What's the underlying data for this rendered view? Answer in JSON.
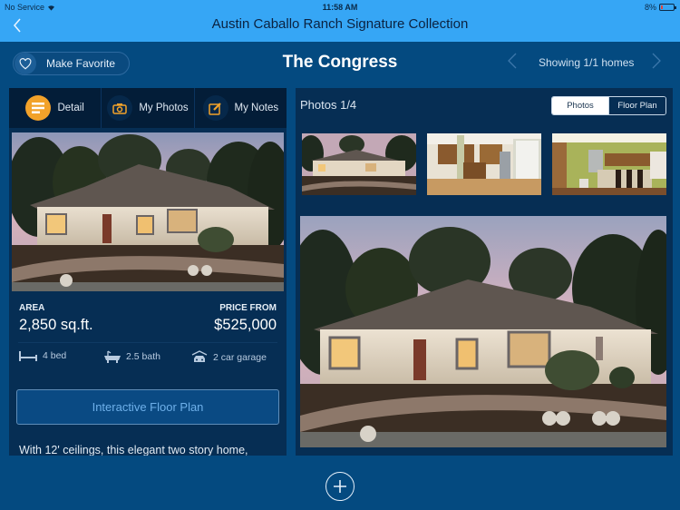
{
  "status_bar": {
    "carrier": "No Service",
    "time": "11:58 AM",
    "battery": "8%"
  },
  "nav": {
    "back_icon": "chevron-left-icon",
    "title": "Austin Caballo Ranch Signature Collection"
  },
  "header": {
    "favorite_label": "Make Favorite",
    "home_title": "The Congress",
    "showing": "Showing 1/1 homes"
  },
  "tabs": [
    {
      "label": "Detail",
      "icon": "list-icon",
      "active": true
    },
    {
      "label": "My Photos",
      "icon": "camera-icon",
      "active": false
    },
    {
      "label": "My Notes",
      "icon": "pencil-icon",
      "active": false
    }
  ],
  "details": {
    "area_label": "AREA",
    "area_value": "2,850 sq.ft.",
    "price_label": "PRICE FROM",
    "price_value": "$525,000",
    "amenities": [
      {
        "icon": "bed-icon",
        "label": "4 bed"
      },
      {
        "icon": "bathtub-icon",
        "label": "2.5 bath"
      },
      {
        "icon": "car-garage-icon",
        "label": "2 car garage"
      }
    ],
    "floor_plan_button": "Interactive Floor Plan",
    "description": "With 12' ceilings, this elegant two story home,"
  },
  "gallery": {
    "count_label": "Photos 1/4",
    "segments": [
      {
        "label": "Photos",
        "selected": true
      },
      {
        "label": "Floor Plan",
        "selected": false
      }
    ],
    "thumbnails": [
      {
        "alt": "Exterior at dusk"
      },
      {
        "alt": "Kitchen"
      },
      {
        "alt": "Kitchen and dining"
      }
    ]
  },
  "colors": {
    "nav_bar": "#36a6f5",
    "background": "#044a80",
    "panel": "#062e54",
    "accent": "#f2a22a"
  }
}
